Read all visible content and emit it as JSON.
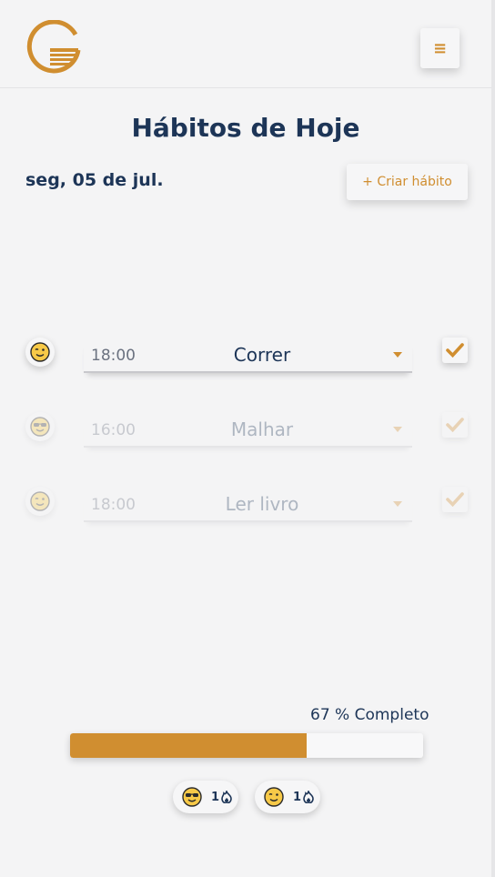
{
  "header": {
    "logo_icon": "habit-tracker-logo",
    "menu_icon": "hamburger-menu-icon",
    "menu_label": "≡",
    "accent_color": "#d08e30"
  },
  "page": {
    "title": "Hábitos de Hoje",
    "date": "seg, 05 de jul.",
    "create_button": "+ Criar hábito"
  },
  "habits": [
    {
      "emoji": "wink-face-icon",
      "time": "18:00",
      "name": "Correr",
      "done": false,
      "faded": false
    },
    {
      "emoji": "sunglasses-face-icon",
      "time": "16:00",
      "name": "Malhar",
      "done": true,
      "faded": true
    },
    {
      "emoji": "wink-face-icon",
      "time": "18:00",
      "name": "Ler livro",
      "done": true,
      "faded": true
    }
  ],
  "progress": {
    "label": "67 % Completo",
    "percent": 67
  },
  "streaks": [
    {
      "emoji": "sunglasses-face-icon",
      "count": "1",
      "icon": "flame-icon"
    },
    {
      "emoji": "wink-face-icon",
      "count": "1",
      "icon": "flame-icon"
    }
  ]
}
